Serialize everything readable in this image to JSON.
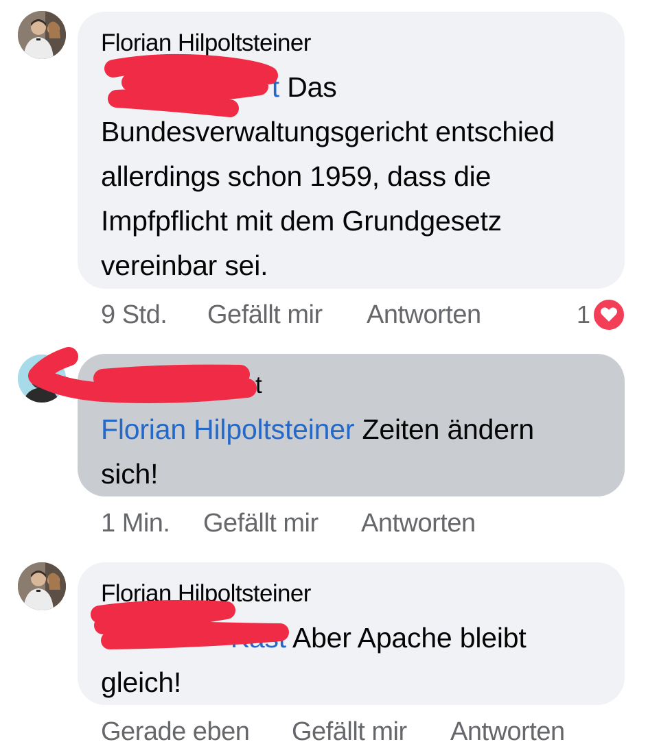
{
  "comments": [
    {
      "author": "Florian Hilpoltsteiner",
      "mention": "t",
      "text": "Das Bundesverwaltungsgericht entschied allerdings schon 1959, dass die Impfpflicht mit dem Grundgesetz vereinbar sei.",
      "lines": [
        "Bundesverwaltungsgericht entschied",
        "allerdings schon 1959, dass die",
        "Impfpflicht mit dem Grundgesetz",
        "vereinbar sei."
      ],
      "first_line_text": "Das",
      "time": "9 Std.",
      "like_label": "Gefällt mir",
      "reply_label": "Antworten",
      "reaction_count": "1",
      "reaction_icon": "heart-icon"
    },
    {
      "author": "t",
      "mention": "Florian Hilpoltsteiner",
      "first_line_text": "Zeiten ändern",
      "second_line": "sich!",
      "time": "1 Min.",
      "like_label": "Gefällt mir",
      "reply_label": "Antworten"
    },
    {
      "author": "Florian Hilpoltsteiner",
      "mention": "Kast",
      "first_line_text": "Aber Apache bleibt",
      "second_line": "gleich!",
      "time": "Gerade eben",
      "like_label": "Gefällt mir",
      "reply_label": "Antworten"
    }
  ],
  "colors": {
    "bubble": "#f0f2f5",
    "bubble_active": "#c9ccd1",
    "mention": "#2468c8",
    "meta": "#65676b",
    "heart": "#f33e58",
    "redaction": "#f02b45"
  }
}
